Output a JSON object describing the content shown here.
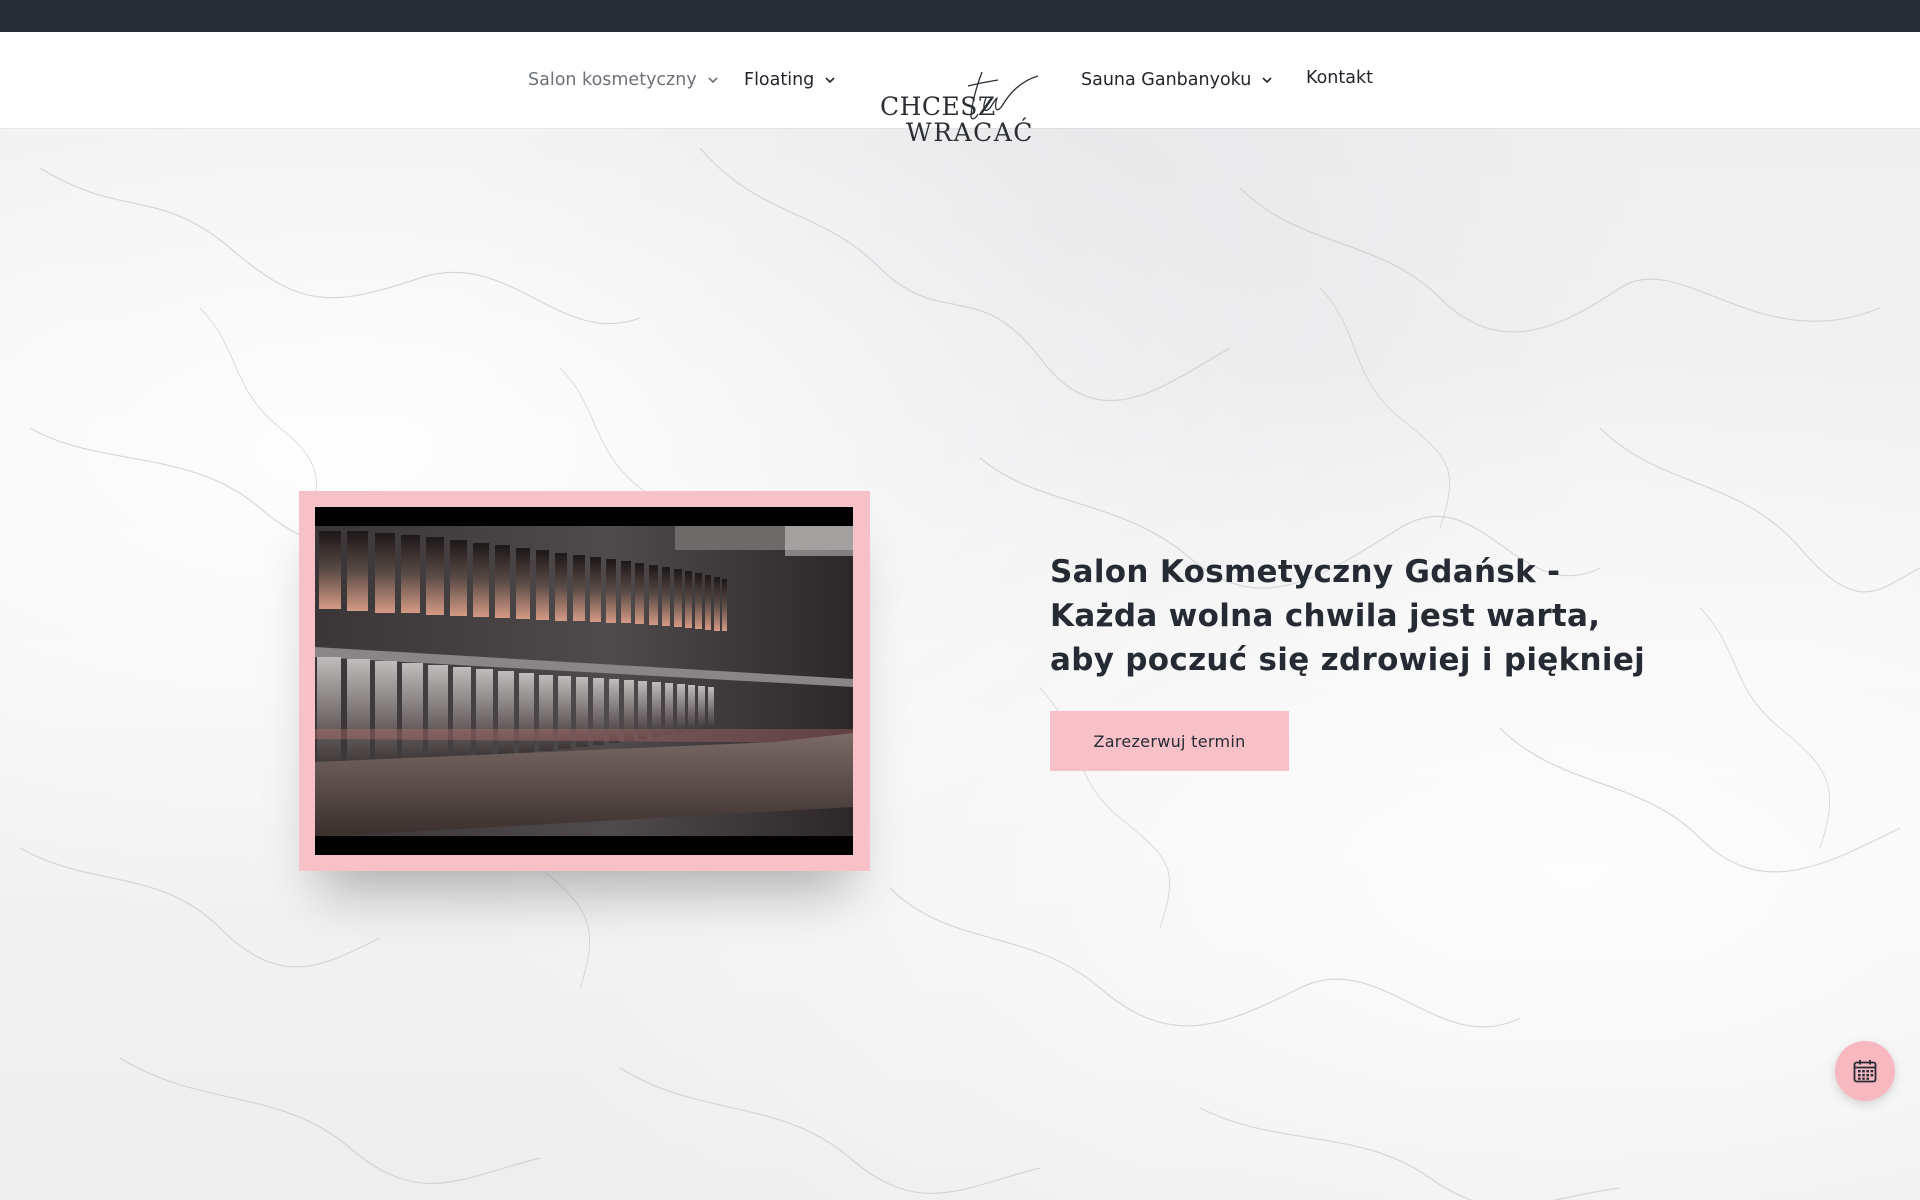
{
  "colors": {
    "topbar": "#252c36",
    "accent_pink": "#f8c0c7",
    "text_dark": "#262b33",
    "text_muted": "#6d7178"
  },
  "nav": {
    "left_items": [
      {
        "label": "Salon kosmetyczny",
        "has_dropdown": true,
        "icon": "chevron-down-icon"
      },
      {
        "label": "Floating",
        "has_dropdown": true,
        "icon": "chevron-down-icon"
      }
    ],
    "right_items": [
      {
        "label": "Sauna Ganbanyoku",
        "has_dropdown": true,
        "icon": "chevron-down-icon"
      },
      {
        "label": "Kontakt",
        "has_dropdown": false
      }
    ]
  },
  "logo": {
    "line1": "CHCESZ",
    "script": "tu",
    "line2": "WRACAĆ"
  },
  "hero": {
    "heading_bold": "Salon Kosmetyczny Gdańsk",
    "heading_rest": " - Każda wolna chwila jest warta, aby poczuć się zdrowiej i piękniej",
    "cta_label": "Zarezerwuj termin"
  },
  "fab": {
    "icon": "calendar-icon"
  }
}
